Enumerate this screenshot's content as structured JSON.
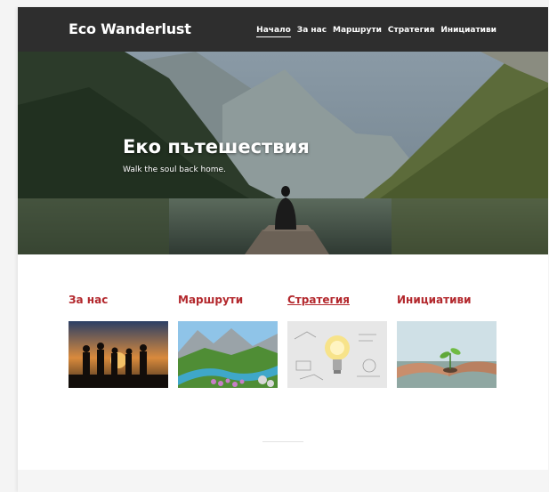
{
  "header": {
    "brand": "Eco Wanderlust",
    "nav": [
      {
        "label": "Начало"
      },
      {
        "label": "За нас"
      },
      {
        "label": "Маршрути"
      },
      {
        "label": "Стратегия"
      },
      {
        "label": "Инициативи"
      }
    ]
  },
  "hero": {
    "title": "Еко пътешествия",
    "subtitle": "Walk the soul back home."
  },
  "cards": [
    {
      "title": "За нас",
      "image": "group-of-people-at-sunset"
    },
    {
      "title": "Маршрути",
      "image": "mountain-valley-with-river-and-flowers"
    },
    {
      "title": "Стратегия",
      "image": "light-bulb-with-sketches"
    },
    {
      "title": "Инициативи",
      "image": "hands-holding-seedling"
    }
  ],
  "colors": {
    "nav_bg": "#2e2e2e",
    "accent": "#b3282d",
    "page_bg": "#ffffff"
  }
}
